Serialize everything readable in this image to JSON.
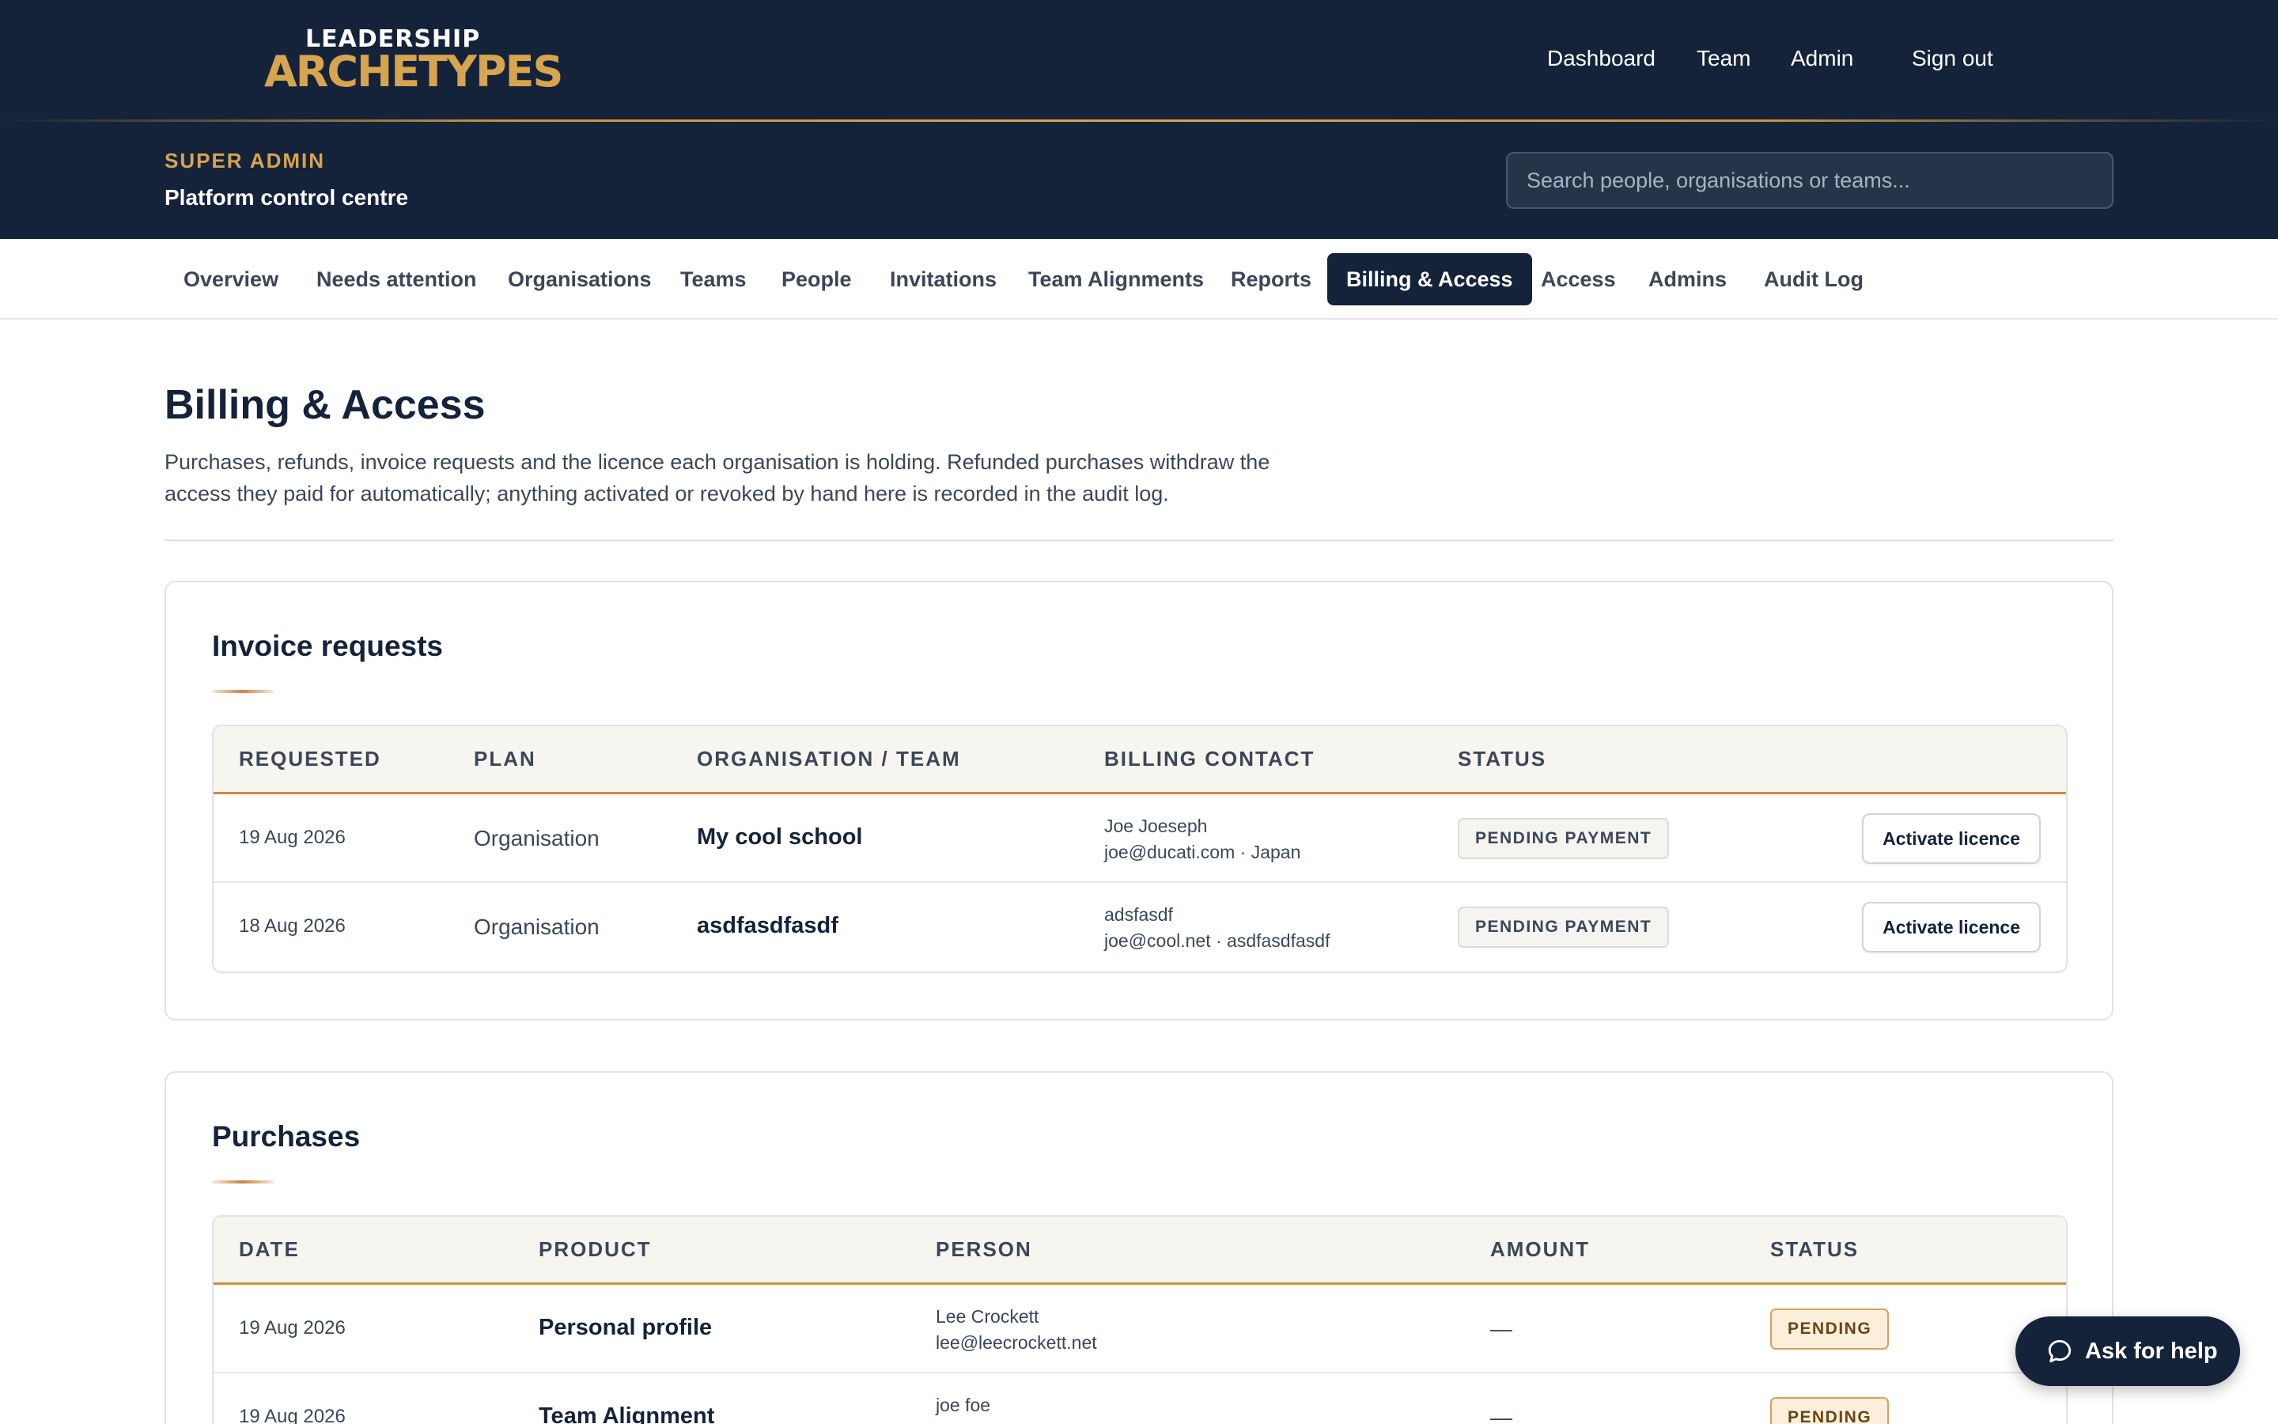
{
  "brand": {
    "line1": "LEADERSHIP",
    "line2": "ARCHETYPES"
  },
  "topnav": {
    "dashboard": "Dashboard",
    "team": "Team",
    "admin": "Admin",
    "signout": "Sign out"
  },
  "role": {
    "label": "SUPER ADMIN",
    "subtitle": "Platform control centre"
  },
  "search": {
    "placeholder": "Search people, organisations or teams..."
  },
  "tabs": [
    {
      "label": "Overview",
      "active": false
    },
    {
      "label": "Needs attention",
      "active": false
    },
    {
      "label": "Organisations",
      "active": false
    },
    {
      "label": "Teams",
      "active": false
    },
    {
      "label": "People",
      "active": false
    },
    {
      "label": "Invitations",
      "active": false
    },
    {
      "label": "Team Alignments",
      "active": false
    },
    {
      "label": "Reports",
      "active": false
    },
    {
      "label": "Billing & Access",
      "active": true
    },
    {
      "label": "Access",
      "active": false
    },
    {
      "label": "Admins",
      "active": false
    },
    {
      "label": "Audit Log",
      "active": false
    }
  ],
  "page": {
    "title": "Billing & Access",
    "description": "Purchases, refunds, invoice requests and the licence each organisation is holding. Refunded purchases withdraw the access they paid for automatically; anything activated or revoked by hand here is recorded in the audit log."
  },
  "invoices": {
    "title": "Invoice requests",
    "headers": {
      "requested": "REQUESTED",
      "plan": "PLAN",
      "org": "ORGANISATION / TEAM",
      "contact": "BILLING CONTACT",
      "status": "STATUS"
    },
    "rows": [
      {
        "requested": "19 Aug 2026",
        "plan": "Organisation",
        "org": "My cool school",
        "contact_name": "Joe Joeseph",
        "contact_detail": "joe@ducati.com · Japan",
        "status": "PENDING PAYMENT",
        "action": "Activate licence"
      },
      {
        "requested": "18 Aug 2026",
        "plan": "Organisation",
        "org": "asdfasdfasdf",
        "contact_name": "adsfasdf",
        "contact_detail": "joe@cool.net · asdfasdfasdf",
        "status": "PENDING PAYMENT",
        "action": "Activate licence"
      }
    ]
  },
  "purchases": {
    "title": "Purchases",
    "headers": {
      "date": "DATE",
      "product": "PRODUCT",
      "person": "PERSON",
      "amount": "AMOUNT",
      "status": "STATUS"
    },
    "rows": [
      {
        "date": "19 Aug 2026",
        "product": "Personal profile",
        "person_name": "Lee Crockett",
        "person_email": "lee@leecrockett.net",
        "amount": "—",
        "status": "PENDING"
      },
      {
        "date": "19 Aug 2026",
        "product": "Team Alignment",
        "person_name": "joe foe",
        "person_email": "",
        "amount": "—",
        "status": "PENDING"
      }
    ]
  },
  "help": {
    "label": "Ask for help"
  },
  "colors": {
    "navy": "#14233a",
    "gold": "#d7a450",
    "accent_orange": "#d08b3f"
  }
}
